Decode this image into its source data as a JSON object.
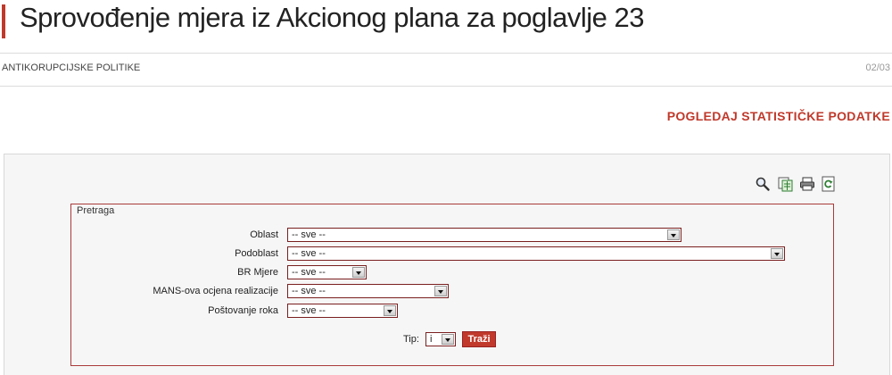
{
  "header": {
    "title": "Sprovođenje mjera iz Akcionog plana za poglavlje 23"
  },
  "meta": {
    "category": "ANTIKORUPCIJSKE POLITIKE",
    "date": "02/03"
  },
  "stats_link": "POGLEDAJ STATISTIČKE PODATKE",
  "toolbar": {
    "icons": [
      "search-icon",
      "export-icon",
      "print-icon",
      "refresh-icon"
    ]
  },
  "search": {
    "legend": "Pretraga",
    "fields": [
      {
        "label": "Oblast",
        "value": "-- sve --"
      },
      {
        "label": "Podoblast",
        "value": "-- sve --"
      },
      {
        "label": "BR Mjere",
        "value": "-- sve --"
      },
      {
        "label": "MANS-ova ocjena realizacije",
        "value": "-- sve --"
      },
      {
        "label": "Poštovanje roka",
        "value": "-- sve --"
      }
    ],
    "tip_label": "Tip:",
    "tip_value": "i",
    "submit_label": "Traži"
  },
  "colors": {
    "accent": "#c0392b",
    "panel_bg": "#f6f6f6",
    "border": "#a93a3a"
  }
}
